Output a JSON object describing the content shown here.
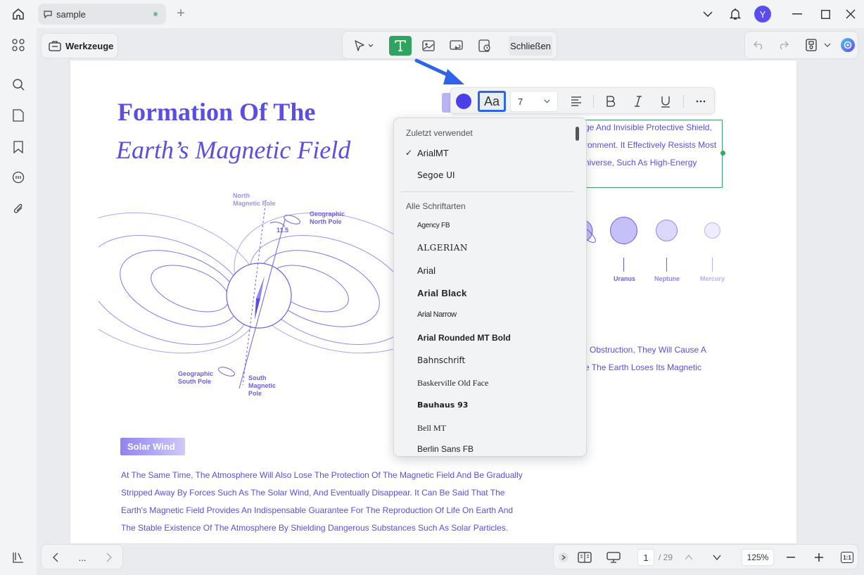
{
  "tab": {
    "title": "sample"
  },
  "user": {
    "initial": "Y"
  },
  "toolbar": {
    "tools_label": "Werkzeuge",
    "close_label": "Schließen"
  },
  "format_bar": {
    "font_button": "Aa",
    "font_size": "7"
  },
  "font_dropdown": {
    "recent_header": "Zuletzt verwendet",
    "recent": [
      {
        "name": "ArialMT",
        "checked": true
      },
      {
        "name": "Segoe UI",
        "checked": false
      }
    ],
    "all_header": "Alle Schriftarten",
    "fonts": [
      "Agency FB",
      "ALGERIAN",
      "Arial",
      "Arial Black",
      "Arial Narrow",
      "Arial Rounded MT Bold",
      "Bahnschrift",
      "Baskerville Old Face",
      "Bauhaus 93",
      "Bell MT",
      "Berlin Sans FB"
    ]
  },
  "document": {
    "title_line1": "Formation Of The",
    "title_line2": "Earth’s Magnetic Field",
    "textbox_lines": [
      "ge And Invisible Protective Shield,",
      "ronment. It Effectively Resists Most",
      "niverse, Such As High-Energy"
    ],
    "diagram": {
      "north_magnetic": [
        "North",
        "Magnetic Pole"
      ],
      "geo_north": [
        "Geographic",
        "North Pole"
      ],
      "angle": "11.5",
      "geo_south": [
        "Geographic",
        "South Pole"
      ],
      "south_magnetic": [
        "South",
        "Magnetic",
        "Pole"
      ]
    },
    "planets": [
      {
        "name": "Uranus",
        "color": "#6a5fe8"
      },
      {
        "name": "Neptune",
        "color": "#8f86ef"
      },
      {
        "name": "Mercury",
        "color": "#b8b2f5"
      }
    ],
    "mid_lines": [
      "Obstruction, They Will Cause A",
      "e The Earth Loses Its Magnetic"
    ],
    "solar_badge": "Solar Wind",
    "paragraph": [
      "At The Same Time, The Atmosphere Will Also Lose The Protection Of The Magnetic Field And Be Gradually",
      "Stripped Away By Forces Such As The Solar Wind, And Eventually Disappear. It Can Be Said That The",
      "Earth's Magnetic Field Provides An Indispensable Guarantee For The Reproduction Of Life On Earth And",
      "The Stable Existence Of The Atmosphere By Shielding Dangerous Substances Such As Solar Particles."
    ]
  },
  "navigation": {
    "more": "...",
    "current_page": "1",
    "total_pages": "/ 29",
    "zoom": "125%",
    "fit_label": "1:1"
  },
  "colors": {
    "accent": "#2fa35f",
    "highlight": "#2f64e8",
    "doc_text": "#5a4fe0"
  }
}
